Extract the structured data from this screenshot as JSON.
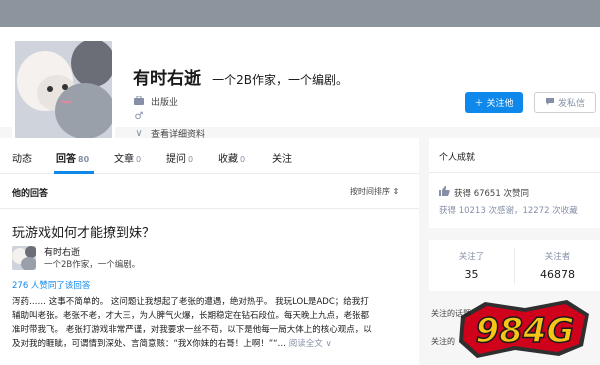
{
  "profile": {
    "name": "有时右逝",
    "headline": "一个2B作家，一个编剧。",
    "industry": "出版业",
    "gender_symbol": "♂",
    "details_link": "查看详细资料",
    "follow_button": "关注他",
    "message_button": "发私信"
  },
  "tabs": [
    {
      "label": "动态",
      "count": ""
    },
    {
      "label": "回答",
      "count": "80"
    },
    {
      "label": "文章",
      "count": "0"
    },
    {
      "label": "提问",
      "count": "0"
    },
    {
      "label": "收藏",
      "count": "0"
    },
    {
      "label": "关注",
      "count": ""
    }
  ],
  "answers": {
    "heading": "他的回答",
    "sort_label": "按时间排序",
    "item": {
      "question": "玩游戏如何才能撩到妹？",
      "author_name": "有时右逝",
      "author_bio": "一个2B作家，一个编剧。",
      "upvotes": "276 人赞同了该回答",
      "excerpt_lines": [
        "泻药…… 这事不简单的。 这问题让我想起了老张的遭遇，绝对热乎。 我玩LOL是ADC；给我打",
        "辅助叫老张。老张不老，才大三，为人脾气火爆，长期稳定在钻石段位。每天晚上九点，老张都",
        "准时带我飞。 老张打游戏非常严谨，对我要求一丝不苟，以下是他每一局大体上的核心观点，以",
        "及对我的睚眦，可谓情到深处、言简意赅：“我X你妹的右哥！上啊！”“…"
      ],
      "read_more": "阅读全文 ∨"
    }
  },
  "achievements": {
    "title": "个人成就",
    "upvote_line": "获得 67651 次赞同",
    "thanks_line": "获得 10213 次感谢，12272 次收藏"
  },
  "follow_stats": {
    "following_label": "关注了",
    "following_count": "35",
    "followers_label": "关注者",
    "followers_count": "46878"
  },
  "side_links": {
    "link1": "关注的话题",
    "link2": "关注的"
  },
  "watermark": "984G",
  "colors": {
    "accent": "#0f88eb",
    "cover": "#8c959d",
    "watermark_red": "#d0021b",
    "watermark_gold": "#f5c518"
  }
}
